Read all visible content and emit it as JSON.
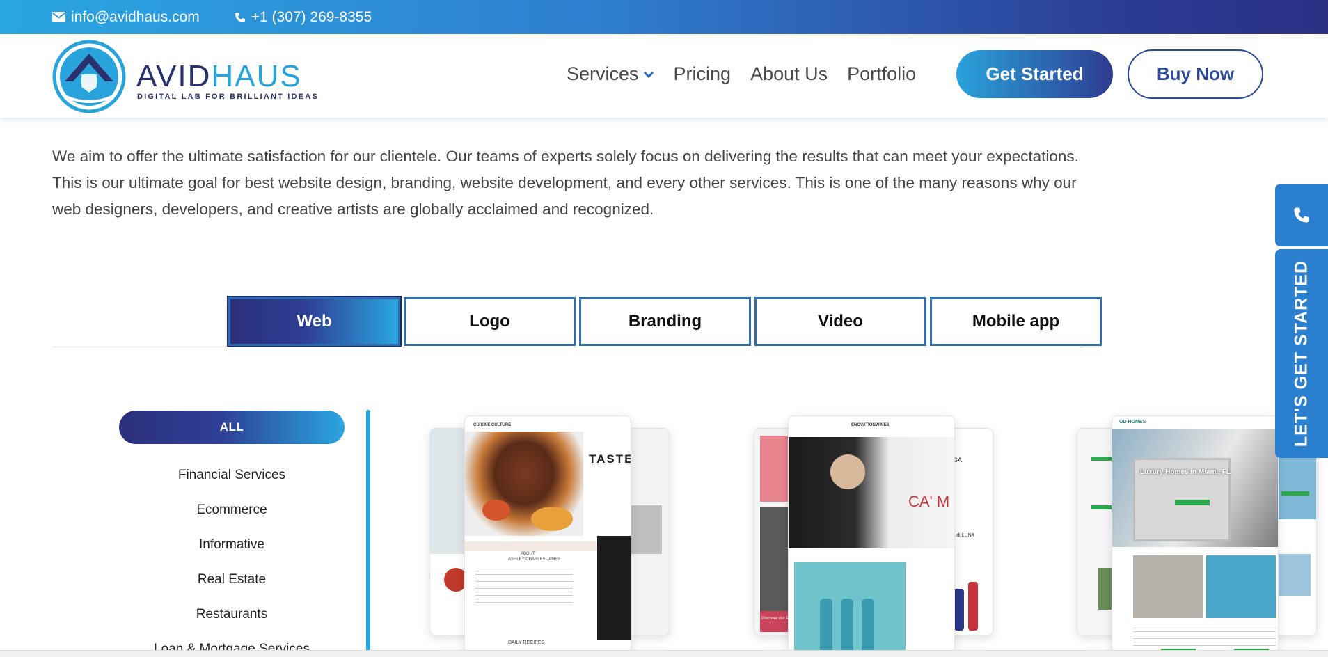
{
  "topbar": {
    "email": "info@avidhaus.com",
    "phone": "+1 (307) 269-8355"
  },
  "header": {
    "logo_word_a": "AVID",
    "logo_word_b": "HAUS",
    "logo_tagline": "DIGITAL LAB FOR BRILLIANT IDEAS",
    "logo_badge": "AVIDHAUS",
    "nav": {
      "services": "Services",
      "pricing": "Pricing",
      "about": "About Us",
      "portfolio": "Portfolio"
    },
    "get_started": "Get Started",
    "buy_now": "Buy Now"
  },
  "intro": {
    "text": "We aim to offer the ultimate satisfaction for our clientele. Our teams of experts solely focus on delivering the results that can meet your expectations. This is our ultimate goal for best website design, branding, website development, and every other services. This is one of the many reasons why our web designers, developers, and creative artists are globally acclaimed and recognized."
  },
  "tabs": [
    "Web",
    "Logo",
    "Branding",
    "Video",
    "Mobile app"
  ],
  "active_tab": "Web",
  "filters": {
    "all_label": "ALL",
    "items": [
      "Financial Services",
      "Ecommerce",
      "Informative",
      "Real Estate",
      "Restaurants",
      "Loan & Mortgage Services"
    ]
  },
  "cards": {
    "card1": {
      "brand": "CUISINE CULTURE",
      "headline": "TASTE",
      "about_title": "ABOUT",
      "about_name": "ASHLEY CHARLES JAMES",
      "recipes": "DAILY RECIPES"
    },
    "card2": {
      "brand": "ENOVATIONWINES",
      "side_text": "CA' M",
      "side_brand": "VOGA",
      "side_brand2": "LUNA di LUNA",
      "discover": "Discover our Products"
    },
    "card3": {
      "brand": "OD HOMES",
      "hero": "Luxury Homes in Miami, FL"
    }
  },
  "side": {
    "cta": "LET'S GET STARTED"
  },
  "colors": {
    "brand_dark": "#2a2f7c",
    "brand_light": "#29a3dc",
    "side_blue": "#2b7fcf"
  }
}
